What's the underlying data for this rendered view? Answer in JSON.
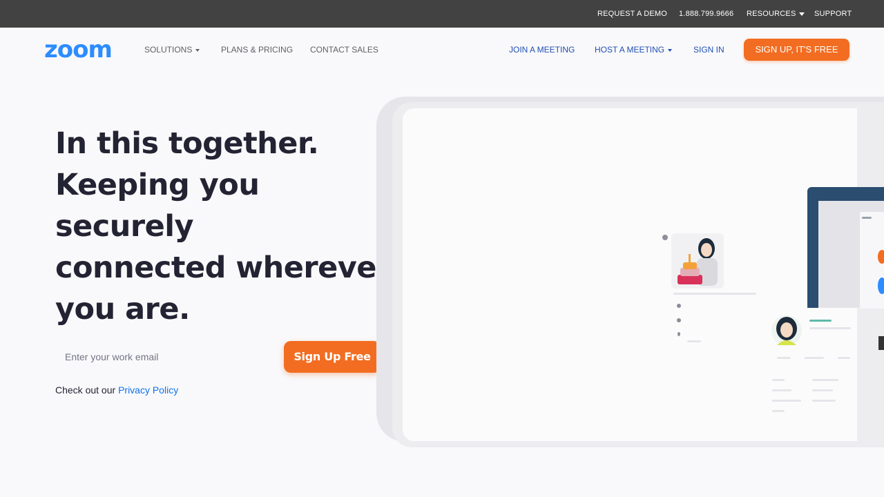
{
  "topbar": {
    "request_demo": "REQUEST A DEMO",
    "phone": "1.888.799.9666",
    "resources": "RESOURCES",
    "support": "SUPPORT"
  },
  "nav": {
    "logo_text": "zoom",
    "solutions": "SOLUTIONS",
    "plans": "PLANS & PRICING",
    "contact": "CONTACT SALES",
    "join": "JOIN A MEETING",
    "host": "HOST A MEETING",
    "sign_in": "SIGN IN",
    "signup": "SIGN UP, IT'S FREE"
  },
  "hero": {
    "headline_lines": [
      "In this together.",
      "Keeping you",
      "securely",
      "connected wherever",
      "you are."
    ],
    "email_placeholder": "Enter your work email",
    "signup_button": "Sign Up Free",
    "privacy_prefix": "Check out our ",
    "privacy_link": "Privacy Policy"
  },
  "colors": {
    "brand_blue": "#2D8CFF",
    "accent_orange": "#F26D21",
    "topbar_bg": "#424242"
  }
}
